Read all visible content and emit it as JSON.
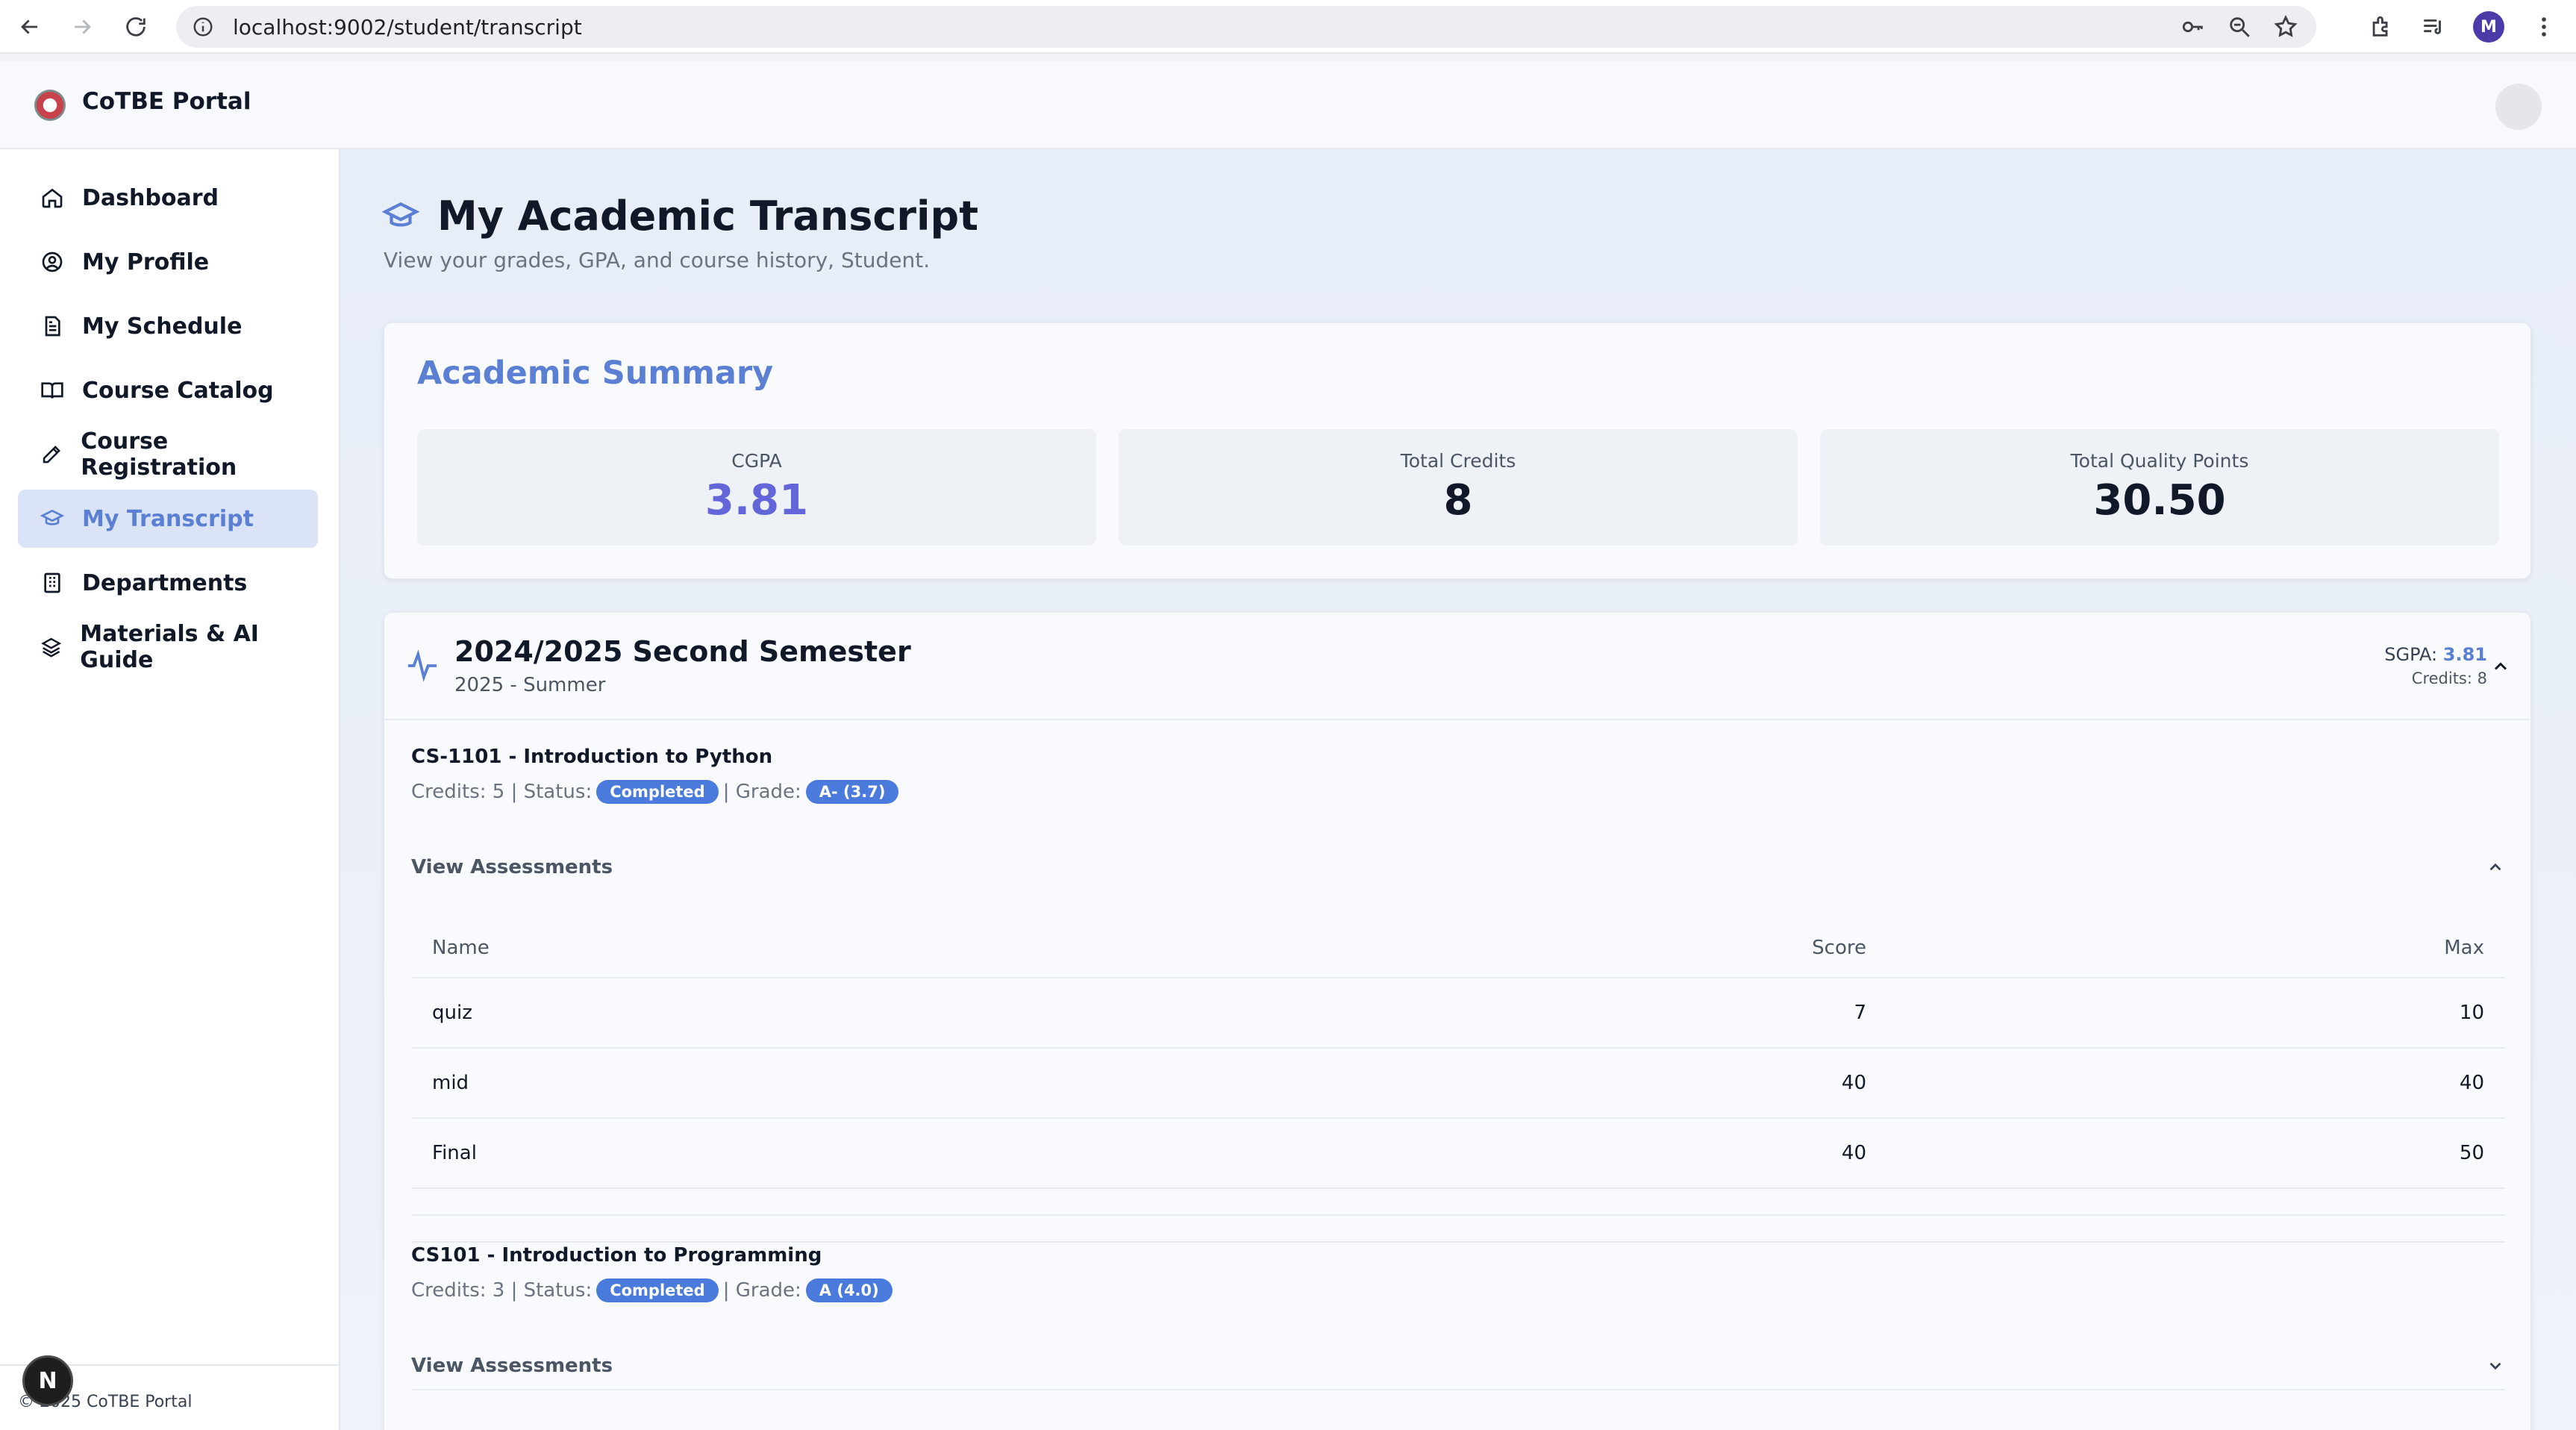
{
  "browser": {
    "url": "localhost:9002/student/transcript",
    "profile_initial": "M"
  },
  "app": {
    "brand": "CoTBE Portal",
    "footer": "© 2025 CoTBE Portal",
    "dev_badge": "N"
  },
  "sidebar": {
    "items": [
      {
        "label": "Dashboard",
        "icon": "home-icon"
      },
      {
        "label": "My Profile",
        "icon": "user-circle-icon"
      },
      {
        "label": "My Schedule",
        "icon": "document-icon"
      },
      {
        "label": "Course Catalog",
        "icon": "book-icon"
      },
      {
        "label": "Course Registration",
        "icon": "pencil-icon"
      },
      {
        "label": "My Transcript",
        "icon": "graduation-cap-icon",
        "active": true
      },
      {
        "label": "Departments",
        "icon": "building-icon"
      },
      {
        "label": "Materials & AI Guide",
        "icon": "layers-icon"
      }
    ]
  },
  "page": {
    "title": "My Academic Transcript",
    "subtitle": "View your grades, GPA, and course history, Student."
  },
  "summary": {
    "title": "Academic Summary",
    "cgpa_label": "CGPA",
    "cgpa_value": "3.81",
    "credits_label": "Total Credits",
    "credits_value": "8",
    "qp_label": "Total Quality Points",
    "qp_value": "30.50"
  },
  "semester": {
    "title": "2024/2025 Second Semester",
    "subtitle": "2025 - Summer",
    "sgpa_label": "SGPA:",
    "sgpa_value": "3.81",
    "credits": "Credits: 8",
    "courses": [
      {
        "title": "CS-1101 - Introduction to Python",
        "credits_text": "Credits: 5 | Status:",
        "status": "Completed",
        "grade_label": "| Grade:",
        "grade": "A- (3.7)",
        "view_label": "View Assessments",
        "expanded": true,
        "columns": [
          "Name",
          "Score",
          "Max"
        ],
        "assessments": [
          {
            "name": "quiz",
            "score": "7",
            "max": "10"
          },
          {
            "name": "mid",
            "score": "40",
            "max": "40"
          },
          {
            "name": "Final",
            "score": "40",
            "max": "50"
          }
        ]
      },
      {
        "title": "CS101 - Introduction to Programming",
        "credits_text": "Credits: 3 | Status:",
        "status": "Completed",
        "grade_label": "| Grade:",
        "grade": "A (4.0)",
        "view_label": "View Assessments",
        "expanded": false
      }
    ]
  },
  "colors": {
    "accent": "#5a7fd3",
    "pill": "#4a7bdc",
    "cgpa": "#6366d8"
  }
}
